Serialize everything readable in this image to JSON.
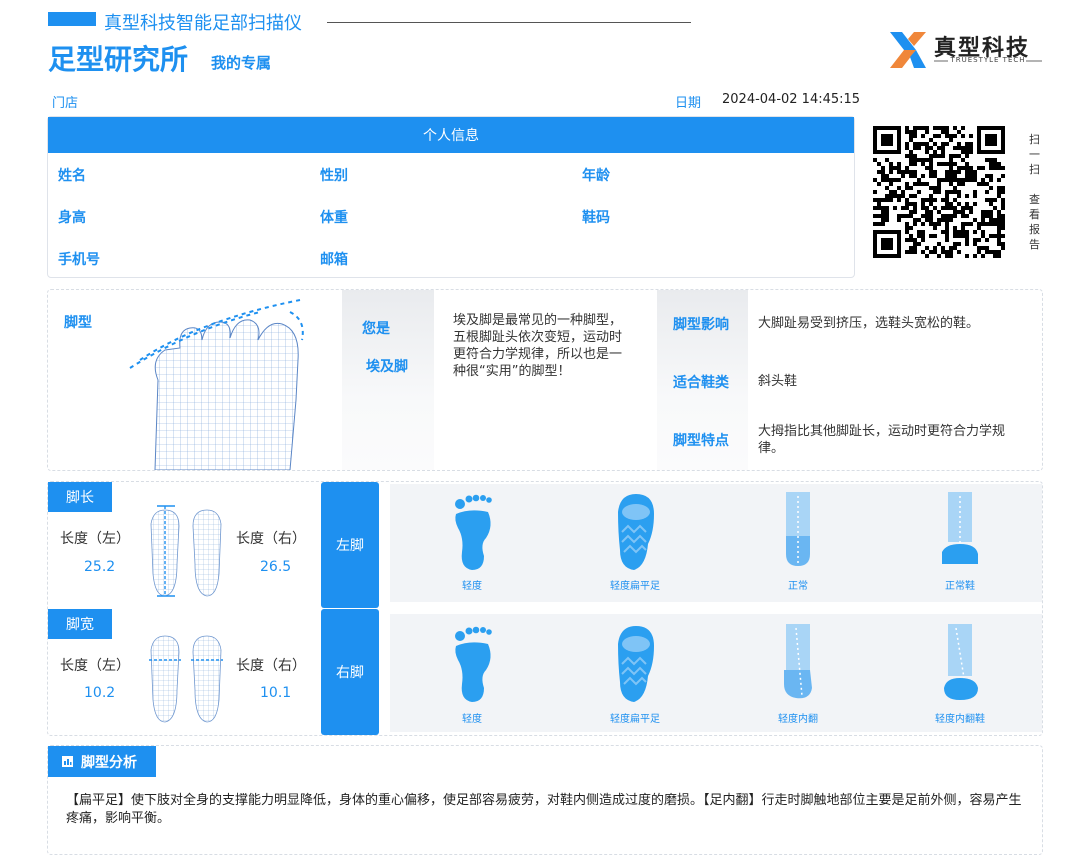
{
  "header": {
    "subtitle": "真型科技智能足部扫描仪",
    "title": "足型研究所",
    "title_sub": "我的专属",
    "logo_text": "真型科技",
    "logo_en": "TRUESTYLE TECH"
  },
  "meta": {
    "store_label": "门店",
    "date_label": "日期",
    "date_value": "2024-04-02 14:45:15"
  },
  "personal": {
    "heading": "个人信息",
    "fields": {
      "name": "姓名",
      "gender": "性别",
      "age": "年龄",
      "height": "身高",
      "weight": "体重",
      "shoe_size": "鞋码",
      "phone": "手机号",
      "email": "邮箱"
    }
  },
  "qr": {
    "scan_line1": "扫一扫",
    "scan_line2": "查看报告"
  },
  "foot_type": {
    "label": "脚型",
    "you_are": "您是",
    "type_name": "埃及脚",
    "description": "埃及脚是最常见的一种脚型，五根脚趾头依次变短，运动时更符合力学规律，所以也是一种很“实用”的脚型！",
    "influence_label": "脚型影响",
    "influence_text": "大脚趾易受到挤压，选鞋头宽松的鞋。",
    "suitable_label": "适合鞋类",
    "suitable_text": "斜头鞋",
    "feature_label": "脚型特点",
    "feature_text": "大拇指比其他脚趾长，运动时更符合力学规律。"
  },
  "measurements": {
    "length": {
      "tag": "脚长",
      "left_label": "长度（左）",
      "right_label": "长度（右）",
      "left_value": "25.2",
      "right_value": "26.5"
    },
    "width": {
      "tag": "脚宽",
      "left_label": "长度（左）",
      "right_label": "长度（右）",
      "left_value": "10.2",
      "right_value": "10.1"
    }
  },
  "left_foot": {
    "tab": "左脚",
    "items": [
      "轻度",
      "轻度扁平足",
      "正常",
      "正常鞋"
    ]
  },
  "right_foot": {
    "tab": "右脚",
    "items": [
      "轻度",
      "轻度扁平足",
      "轻度内翻",
      "轻度内翻鞋"
    ]
  },
  "analysis": {
    "heading": "脚型分析",
    "text": "【扁平足】使下肢对全身的支撑能力明显降低，身体的重心偏移，使足部容易疲劳，对鞋内侧造成过度的磨损。【足内翻】行走时脚触地部位主要是足前外侧，容易产生疼痛，影响平衡。"
  },
  "colors": {
    "accent": "#1e90f0",
    "panel": "#f2f4f7"
  }
}
